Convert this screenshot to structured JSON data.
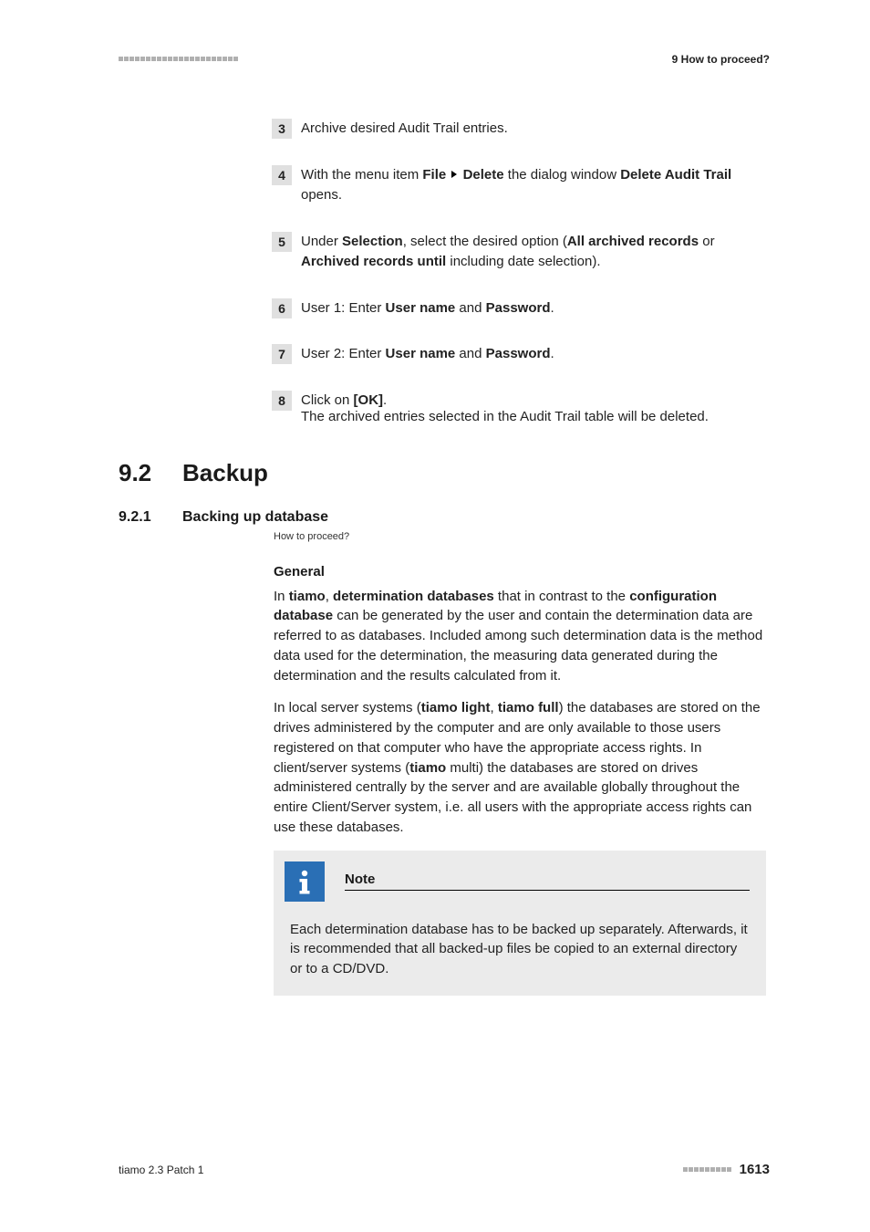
{
  "header": {
    "right": "9 How to proceed?"
  },
  "steps": {
    "s3": {
      "num": "3",
      "text": "Archive desired Audit Trail entries."
    },
    "s4": {
      "num": "4",
      "pre": "With the menu item ",
      "b1": "File",
      "b2": "Delete",
      "mid": " the dialog window ",
      "b3": "Delete Audit Trail",
      "post": " opens."
    },
    "s5": {
      "num": "5",
      "pre": "Under ",
      "b1": "Selection",
      "mid1": ", select the desired option (",
      "b2": "All archived records",
      "mid2": " or ",
      "b3": "Archived records until",
      "post": " including date selection)."
    },
    "s6": {
      "num": "6",
      "pre": "User 1: Enter ",
      "b1": "User name",
      "mid": " and ",
      "b2": "Password",
      "post": "."
    },
    "s7": {
      "num": "7",
      "pre": "User 2: Enter ",
      "b1": "User name",
      "mid": " and ",
      "b2": "Password",
      "post": "."
    },
    "s8": {
      "num": "8",
      "pre": "Click on ",
      "b1": "[OK]",
      "post": ".",
      "sub": "The archived entries selected in the Audit Trail table will be deleted."
    }
  },
  "section": {
    "number": "9.2",
    "title": "Backup"
  },
  "subsection": {
    "number": "9.2.1",
    "title": "Backing up database",
    "breadcrumb": "How to proceed?"
  },
  "general": {
    "heading": "General",
    "p1": {
      "pre": "In ",
      "b1": "tiamo",
      "mid1": ", ",
      "b2": "determination databases",
      "mid2": " that in contrast to the ",
      "b3": "configuration database",
      "post": " can be generated by the user and contain the determination data are referred to as databases. Included among such determination data is the method data used for the determination, the measuring data generated during the determination and the results calculated from it."
    },
    "p2": {
      "pre": "In local server systems (",
      "b1": "tiamo light",
      "mid1": ", ",
      "b2": "tiamo full",
      "mid2": ") the databases are stored on the drives administered by the computer and are only available to those users registered on that computer who have the appropriate access rights. In client/server systems (",
      "b3": "tiamo",
      "post": " multi) the databases are stored on drives administered centrally by the server and are available globally throughout the entire Client/Server system, i.e. all users with the appropriate access rights can use these databases."
    }
  },
  "note": {
    "label": "Note",
    "text": "Each determination database has to be backed up separately. Afterwards, it is recommended that all backed-up files be copied to an external directory or to a CD/DVD."
  },
  "footer": {
    "left": "tiamo 2.3 Patch 1",
    "page": "1613"
  }
}
